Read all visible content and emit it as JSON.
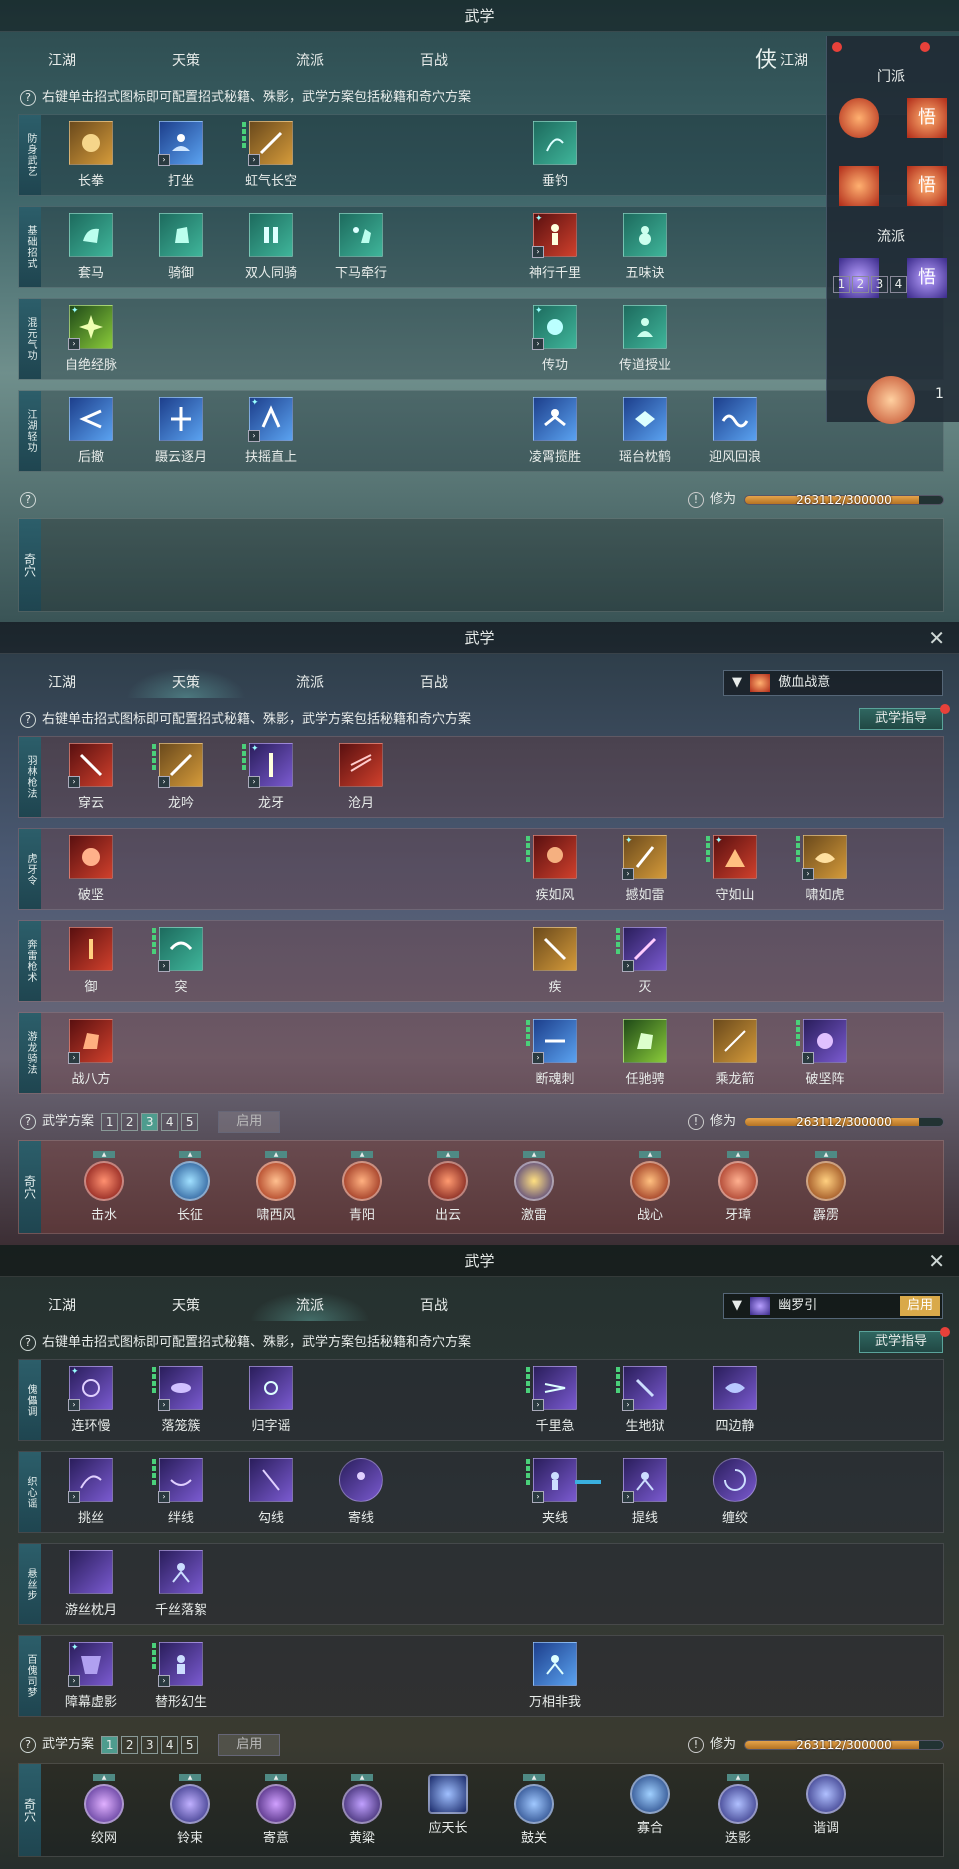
{
  "panels": [
    {
      "title": "武学",
      "tabs": [
        "江湖",
        "天策",
        "流派",
        "百战"
      ],
      "tab_right": {
        "glyph": "侠",
        "label": "江湖"
      },
      "hint": "右键单击招式图标即可配置招式秘籍、殊影，武学方案包括秘籍和奇穴方案",
      "rows": [
        {
          "label": "防身武艺",
          "skills": [
            "长拳",
            "打坐",
            "虹气长空",
            "垂钓"
          ]
        },
        {
          "label": "基础招式",
          "skills": [
            "套马",
            "骑御",
            "双人同骑",
            "下马牵行",
            "神行千里",
            "五味诀"
          ]
        },
        {
          "label": "混元气功",
          "skills": [
            "自绝经脉",
            "传功",
            "传道授业"
          ]
        },
        {
          "label": "江湖轻功",
          "skills": [
            "后撤",
            "蹑云逐月",
            "扶摇直上",
            "凌霄揽胜",
            "瑶台枕鹤",
            "迎风回浪"
          ]
        }
      ],
      "xiuwei_label": "修为",
      "xiuwei_text": "263112/300000",
      "xiuwei_fraction": 0.877,
      "qixue_label": "奇穴",
      "side": {
        "menpai": "门派",
        "liupai": "流派",
        "numbers": [
          "1",
          "2",
          "3",
          "4"
        ],
        "right_badge": "1",
        "wu": "悟"
      }
    },
    {
      "title": "武学",
      "tabs": [
        "江湖",
        "天策",
        "流派",
        "百战"
      ],
      "dropdown_value": "傲血战意",
      "hint": "右键单击招式图标即可配置招式秘籍、殊影，武学方案包括秘籍和奇穴方案",
      "guide": "武学指导",
      "rows": [
        {
          "label": "羽林枪法",
          "skills": [
            "穿云",
            "龙吟",
            "龙牙",
            "沧月"
          ]
        },
        {
          "label": "虎牙令",
          "skills": [
            "破坚",
            "疾如风",
            "撼如雷",
            "守如山",
            "啸如虎"
          ]
        },
        {
          "label": "奔雷枪术",
          "skills": [
            "御",
            "突",
            "疾",
            "灭"
          ]
        },
        {
          "label": "游龙骑法",
          "skills": [
            "战八方",
            "断魂刺",
            "任驰骋",
            "乘龙箭",
            "破坚阵"
          ]
        }
      ],
      "scheme_label": "武学方案",
      "scheme_numbers": [
        "1",
        "2",
        "3",
        "4",
        "5"
      ],
      "scheme_selected": "3",
      "enable": "启用",
      "xiuwei_label": "修为",
      "xiuwei_text": "263112/300000",
      "xiuwei_fraction": 0.877,
      "qixue_label": "奇穴",
      "qixue": [
        "击水",
        "长征",
        "啸西风",
        "青阳",
        "出云",
        "激雷",
        "战心",
        "牙璋",
        "霹雳"
      ]
    },
    {
      "title": "武学",
      "tabs": [
        "江湖",
        "天策",
        "流派",
        "百战"
      ],
      "dropdown_value": "幽罗引",
      "dropdown_btn": "启用",
      "hint": "右键单击招式图标即可配置招式秘籍、殊影，武学方案包括秘籍和奇穴方案",
      "guide": "武学指导",
      "rows": [
        {
          "label": "傀儡调",
          "skills": [
            "连环慢",
            "落笼簇",
            "归字谣",
            "千里急",
            "生地狱",
            "四边静"
          ]
        },
        {
          "label": "织心谣",
          "skills": [
            "挑丝",
            "绊线",
            "勾线",
            "寄线",
            "夹线",
            "提线",
            "缠绞"
          ]
        },
        {
          "label": "悬丝步",
          "skills": [
            "游丝枕月",
            "千丝落絮"
          ]
        },
        {
          "label": "百傀司梦",
          "skills": [
            "障幕虚影",
            "替形幻生",
            "万相非我"
          ]
        }
      ],
      "scheme_label": "武学方案",
      "scheme_numbers": [
        "1",
        "2",
        "3",
        "4",
        "5"
      ],
      "scheme_selected": "1",
      "enable": "启用",
      "xiuwei_label": "修为",
      "xiuwei_text": "263112/300000",
      "xiuwei_fraction": 0.877,
      "qixue_label": "奇穴",
      "qixue": [
        "绞网",
        "铃束",
        "寄意",
        "黄粱",
        "应天长",
        "鼓关",
        "寡合",
        "迭影",
        "谐调"
      ]
    }
  ],
  "colors": {
    "accent": "#4e9c8e",
    "notify": "#e8413a",
    "exp": "#d9953e"
  }
}
